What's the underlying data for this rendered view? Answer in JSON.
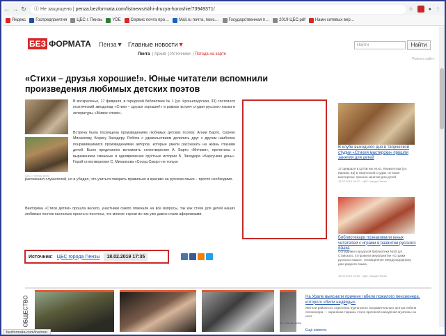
{
  "browser": {
    "url_prefix": "Не защищено",
    "url": "penza.bezformata.com/listnews/stihi-druzya-horoshie/73949371/",
    "bookmarks": [
      "Яндекс",
      "Госпредприятия",
      "ЦБС г. Пензы",
      "YDE",
      "Сервис почта про…",
      "Mail.ru почта, поис…",
      "Государственная п…",
      "2019 ЦБС.pdf",
      "Нами сетевых вер…"
    ]
  },
  "site": {
    "logo_red": "БЕЗ",
    "logo_dark": "ФОРМАТА",
    "city": "Пенза▼",
    "main_news": "Главные новости",
    "main_news_arrow": "▼",
    "subnav": {
      "active": "Лента",
      "items": [
        "Архив",
        "Источники"
      ],
      "red": "Погода на карте"
    },
    "search_placeholder": "Найти",
    "search_button": "Найти",
    "nosite": "Поиск в сайте"
  },
  "article": {
    "headline": "«Стихи – друзья хорошие!». Юные читатели вспомнили произведения любимых детских поэтов",
    "photo_caption": "ЦБС г. Пензы фото",
    "p1": "В воскресенье, 17 февраля, в городской библиотеке № 1 (ул. Кронштадтская, 33) состоялся поэтический звездопад «Стихи – друзья хорошие!» в рамках встреч студии русского языка и литературы «Живое слово».",
    "p2": "Встреча была посвящена произведениям любимых детских поэтов: Агнии Барто, Сергею Михалкову, Борису Заходеру. Ребята с удовольствием делились друг с другом наиболее понравившимися произведениями авторов, которые умели рассказать на жизнь глазами детей. Было предложено вспомнить стихотворения А. Барто «Мячики», прочитаны с выражением смешные и одновременно грустные истории Б. Заходера «Барсучкин день». Герой стихотворения С. Михалкова «Сосед Смыр» не только",
    "p3": "рассмешил слушателей, но и убедил, что учиться говорить правильно и красиво на русском языке – просто необходимо.",
    "p4": "Викторина «Стихи детям» прошла весело, участники смело отвечали на все вопросы, так как стихи для детей наших любимых поэтов настолько просты и понятны, что многие строки из них уже давно стали афоризмами.",
    "source_label": "Источник:",
    "source_link": "ЦБС города Пензы",
    "date": "18.02.2019 17:35"
  },
  "sidebar": {
    "item1": {
      "link": "В клубе выходного дня в творческой студии «Стихия мастерски» прошли занятия для детей",
      "text": "17 февраля в ЦГПБ им. М.Ю. Лермонтова (ул. Кирова, 54) в творческой студии «Стихия мастерски» прошли занятия для детей",
      "date": "18.02.2019 16:17 · ЦБС города Пензы"
    },
    "item2": {
      "link": "Библиотекари познакомили юных читателей с играми в развитии русского языка",
      "text": "Сотрудники городской библиотеки №15 (ул. Ставского, 4) провели мероприятие «Стражи русского языка», посвящённое Международному дню родного языка.",
      "date": "18.02.2019 16:00 · ЦБС города Пензы"
    }
  },
  "bottom": {
    "section_label": "ОБЩЕСТВО",
    "link": "На Урале выяснили причину гибели пожилого пенсионера, которого «били недвиды»",
    "text": "Жители районного отделения Курганского исправительного центра гибели пенсионера — охранники тюрьмы стало причиной нападения мужчины на него.",
    "small": "их только ноги",
    "small2": "Ещё новости"
  },
  "status": "bezformata.com/instrnet"
}
